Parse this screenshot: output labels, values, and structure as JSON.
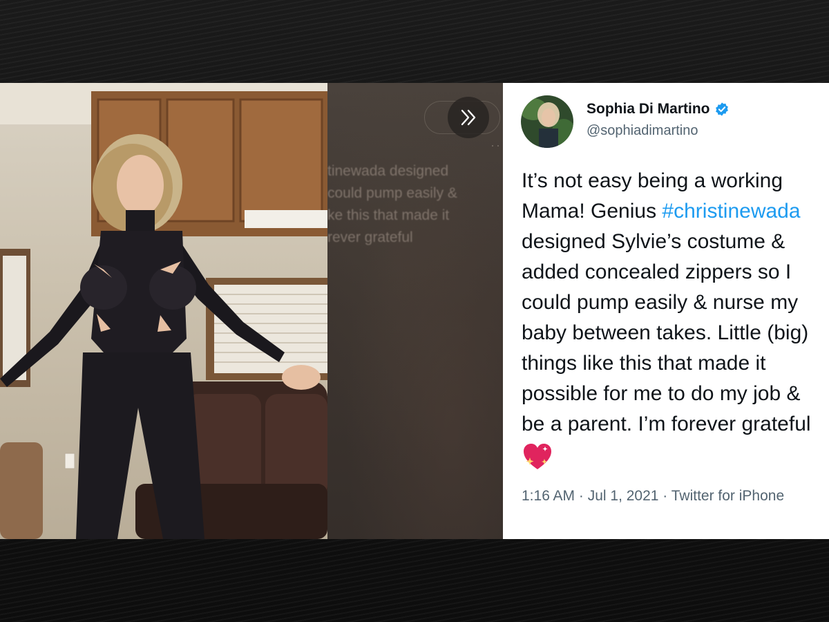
{
  "tweet": {
    "display_name": "Sophia Di Martino",
    "handle": "@sophiadimartino",
    "body": {
      "line1": "It’s not easy being a working",
      "line2_pre": "Mama! Genius ",
      "hashtag": "#christinewada",
      "line3": "designed Sylvie’s costume &",
      "line4": "added concealed zippers so I",
      "line5": "could pump easily & nurse my",
      "line6": "baby between takes. Little (big)",
      "line7": "things like this that made it",
      "line8": "possible for me to do my job &",
      "line9": "be a parent. I’m forever grateful"
    },
    "timestamp": "1:16 AM · Jul 1, 2021 · Twitter for iPhone"
  },
  "blurred_overlay": {
    "text": "tinewada designed\ncould pump easily &\nke this that made it\nrever grateful"
  },
  "icons": {
    "verified": "verified-badge-icon",
    "next": "double-chevron-right-icon",
    "heart": "sparkling-heart-icon"
  },
  "colors": {
    "hashtag": "#1d9bf0",
    "verified": "#1d9bf0",
    "text": "#0f1419",
    "secondary_text": "#536471",
    "heart": "#e0245e"
  }
}
